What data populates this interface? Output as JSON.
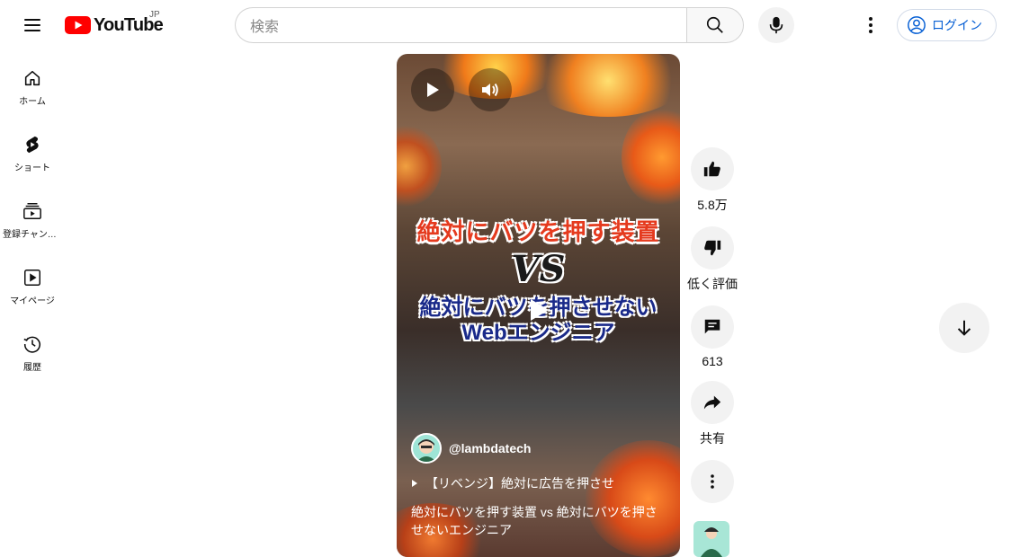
{
  "header": {
    "logo_text": "YouTube",
    "region": "JP",
    "search_placeholder": "検索",
    "login_label": "ログイン"
  },
  "sidebar": {
    "items": [
      {
        "label": "ホーム",
        "icon": "home-icon"
      },
      {
        "label": "ショート",
        "icon": "shorts-icon"
      },
      {
        "label": "登録チャンネル",
        "icon": "subscriptions-icon"
      },
      {
        "label": "マイページ",
        "icon": "you-icon"
      },
      {
        "label": "履歴",
        "icon": "history-icon"
      }
    ]
  },
  "short": {
    "caption_line1": "絶対にバツを押す装置",
    "caption_vs": "VS",
    "caption_line2": "絶対にバツを押させない",
    "caption_line3": "Webエンジニア",
    "channel_handle": "@lambdatech",
    "related_video": "【リベンジ】絶対に広告を押させ",
    "title": "絶対にバツを押す装置 vs 絶対にバツを押させないエンジニア"
  },
  "actions": {
    "like_count": "5.8万",
    "dislike_label": "低く評価",
    "comment_count": "613",
    "share_label": "共有"
  },
  "colors": {
    "brand_red": "#ff0000",
    "link_blue": "#065fd4",
    "button_bg": "#f2f2f2"
  }
}
